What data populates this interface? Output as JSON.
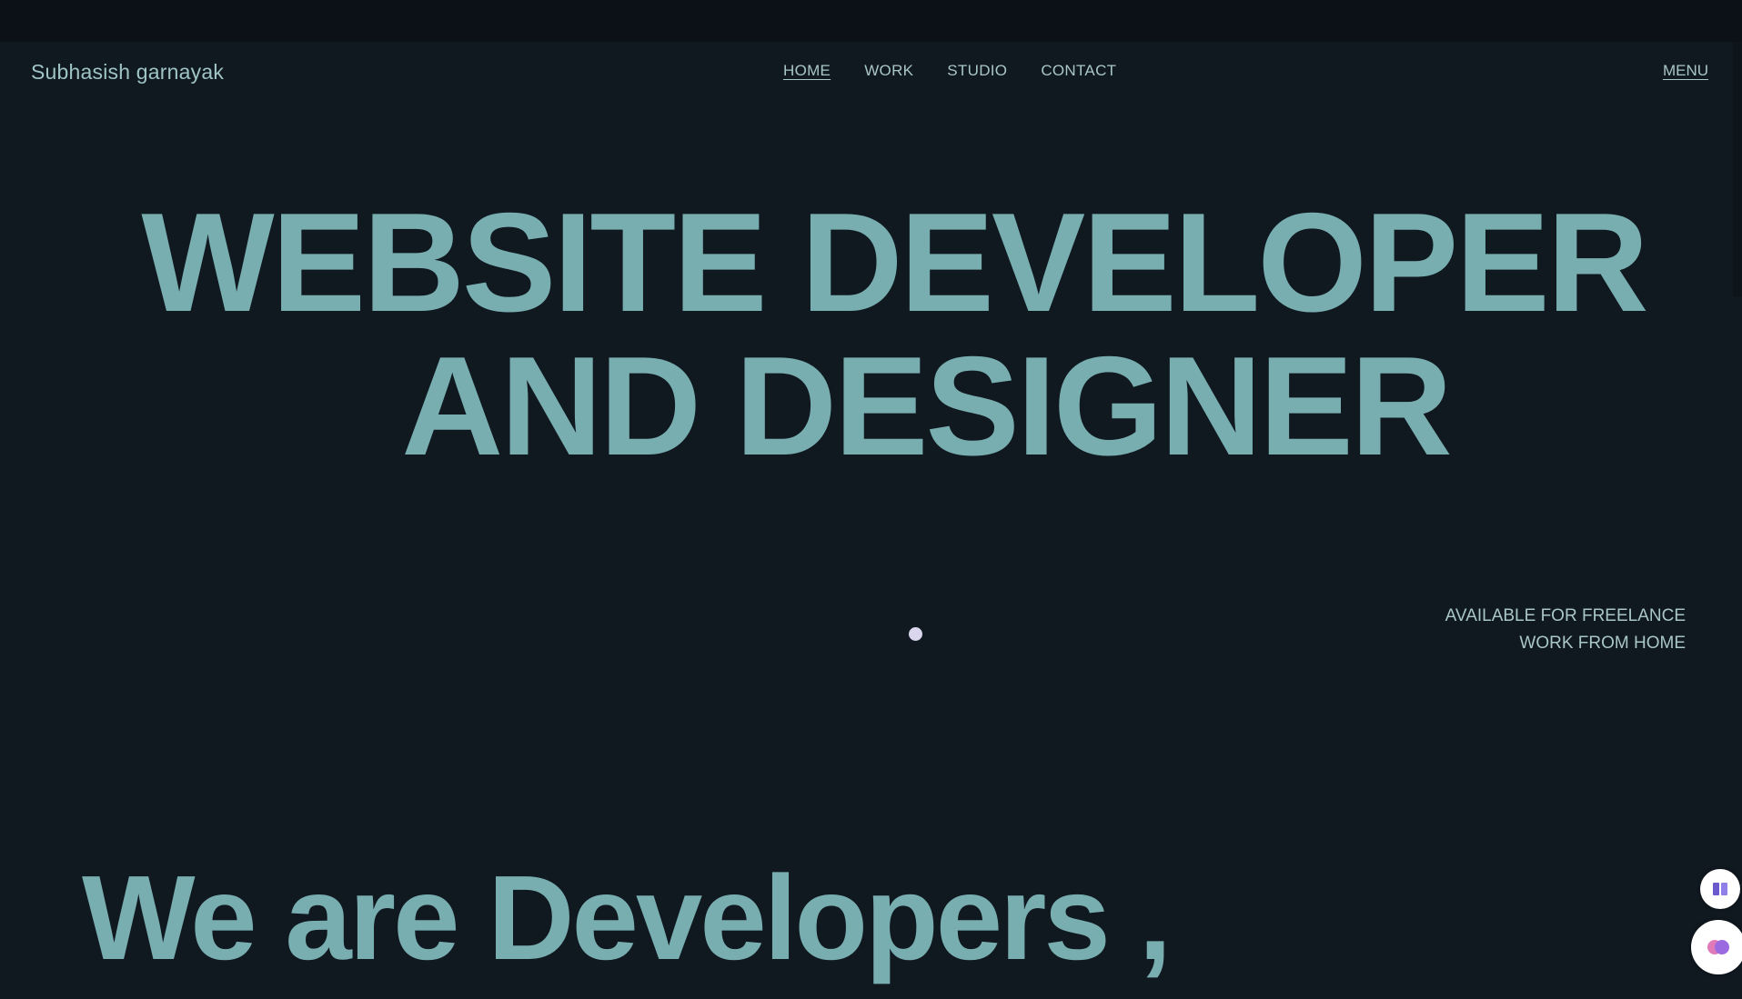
{
  "header": {
    "brand": "Subhasish garnayak",
    "nav": [
      "HOME",
      "WORK",
      "STUDIO",
      "CONTACT"
    ],
    "menu_label": "MENU"
  },
  "hero": {
    "line1": "WEBSITE DEVELOPER",
    "line2": "AND DESIGNER"
  },
  "availability": {
    "line1": "AVAILABLE FOR FREELANCE",
    "line2": "WORK FROM HOME"
  },
  "section2": {
    "heading": "We are Developers ,"
  },
  "colors": {
    "background": "#101820",
    "accent": "#78aeb0",
    "text": "#a9c6c8",
    "cursor_dot": "#d9d6ee"
  },
  "icons": [
    "reader-icon",
    "brain-icon"
  ]
}
